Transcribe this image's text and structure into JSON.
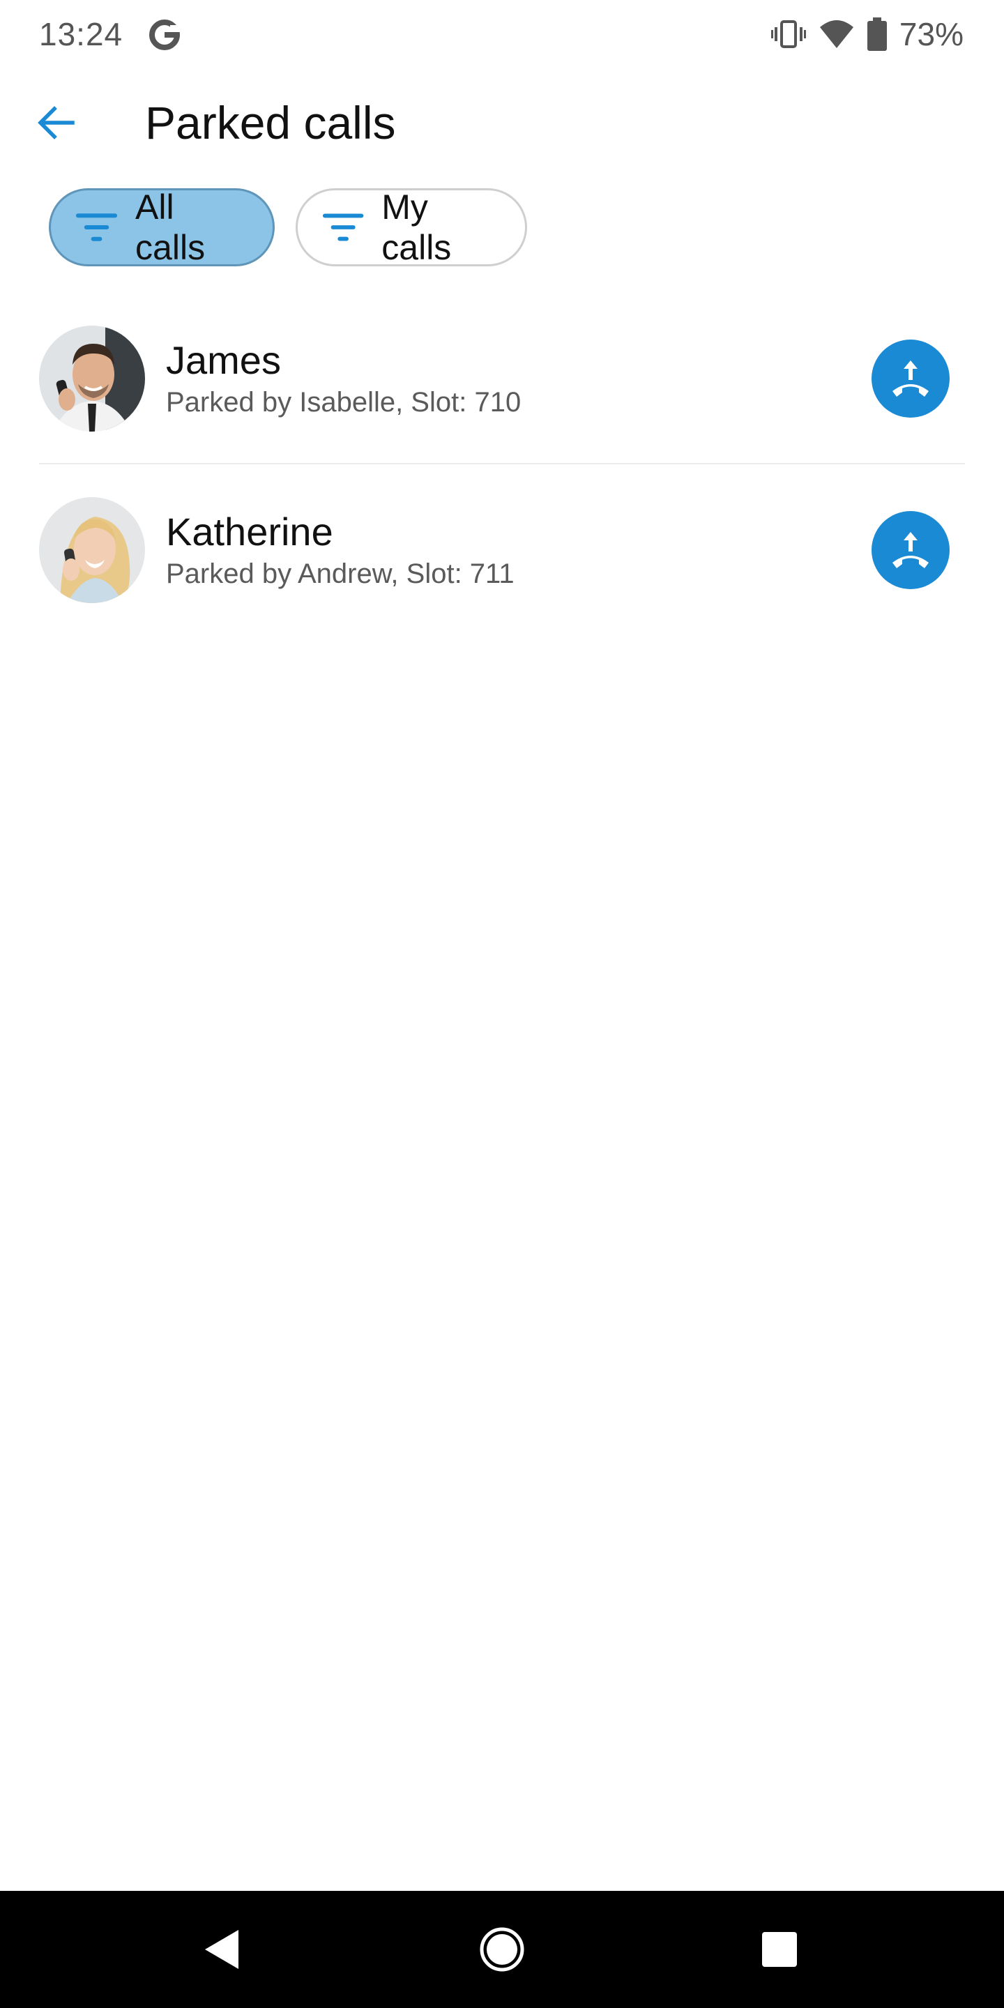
{
  "status_bar": {
    "time": "13:24",
    "battery_percent": "73%",
    "icons": [
      "google-icon",
      "vibrate-icon",
      "wifi-icon",
      "battery-icon"
    ]
  },
  "app_bar": {
    "title": "Parked calls",
    "back_icon": "back-arrow-icon"
  },
  "filters": [
    {
      "label": "All calls",
      "active": true,
      "icon": "filter-icon"
    },
    {
      "label": "My calls",
      "active": false,
      "icon": "filter-icon"
    }
  ],
  "parked_calls": [
    {
      "name": "James",
      "detail": "Parked by Isabelle, Slot: 710",
      "avatar": "man-on-phone-avatar",
      "action_icon": "pickup-call-icon"
    },
    {
      "name": "Katherine",
      "detail": "Parked by Andrew, Slot: 711",
      "avatar": "woman-on-phone-avatar",
      "action_icon": "pickup-call-icon"
    }
  ],
  "nav_bar": {
    "buttons": [
      "back-triangle-icon",
      "home-circle-icon",
      "recents-square-icon"
    ]
  },
  "colors": {
    "accent": "#1a8ad4",
    "chip_active_bg": "#8cc4e8",
    "chip_active_border": "#5f95b8",
    "chip_inactive_border": "#cfcfcf",
    "divider": "#ececec",
    "nav_bar_bg": "#000000"
  }
}
